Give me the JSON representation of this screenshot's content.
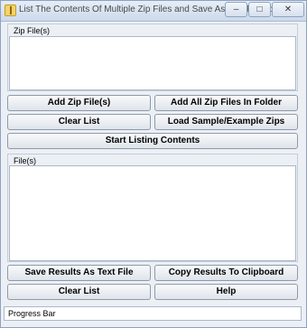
{
  "window": {
    "title": "List The Contents Of Multiple Zip Files and Save As Text File Software",
    "minimize": "–",
    "maximize": "□",
    "close": "✕"
  },
  "zip_group": {
    "label": "Zip File(s)"
  },
  "buttons": {
    "add_zip": "Add Zip File(s)",
    "add_all_folder": "Add All Zip Files In Folder",
    "clear_list_top": "Clear List",
    "load_sample": "Load Sample/Example Zips",
    "start_listing": "Start Listing Contents",
    "save_results": "Save Results As Text File",
    "copy_results": "Copy Results To Clipboard",
    "clear_list_bottom": "Clear List",
    "help": "Help"
  },
  "files_group": {
    "label": "File(s)"
  },
  "status_bar": {
    "text": "Progress Bar"
  }
}
